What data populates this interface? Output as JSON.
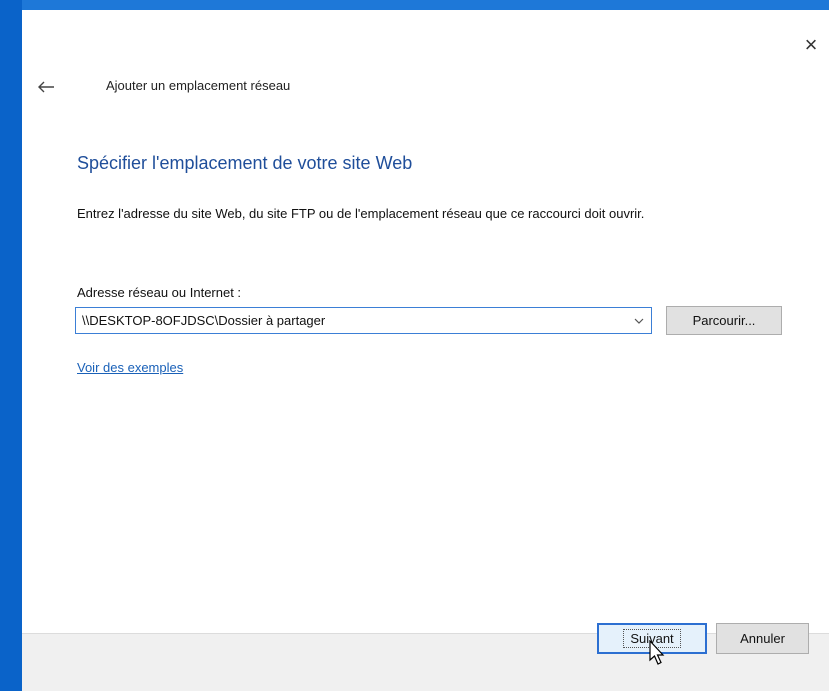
{
  "window": {
    "header_title": "Ajouter un emplacement réseau",
    "close_glyph": "×"
  },
  "content": {
    "main_title": "Spécifier l'emplacement de votre site Web",
    "description": "Entrez l'adresse du site Web, du site FTP ou de l'emplacement réseau que ce raccourci doit ouvrir.",
    "address_label": "Adresse réseau ou Internet :",
    "address_value": "\\\\DESKTOP-8OFJDSC\\Dossier à partager",
    "browse_label": "Parcourir...",
    "examples_link": "Voir des exemples"
  },
  "footer": {
    "next_label": "Suivant",
    "cancel_label": "Annuler"
  },
  "icons": {
    "back": "back-arrow-icon",
    "close": "close-icon",
    "dropdown": "chevron-down-icon",
    "cursor": "mouse-pointer-icon"
  },
  "colors": {
    "accent_blue": "#0a63c9",
    "title_blue": "#1f4e9a",
    "link_blue": "#1a61b8",
    "footer_gray": "#f0f0f0"
  }
}
